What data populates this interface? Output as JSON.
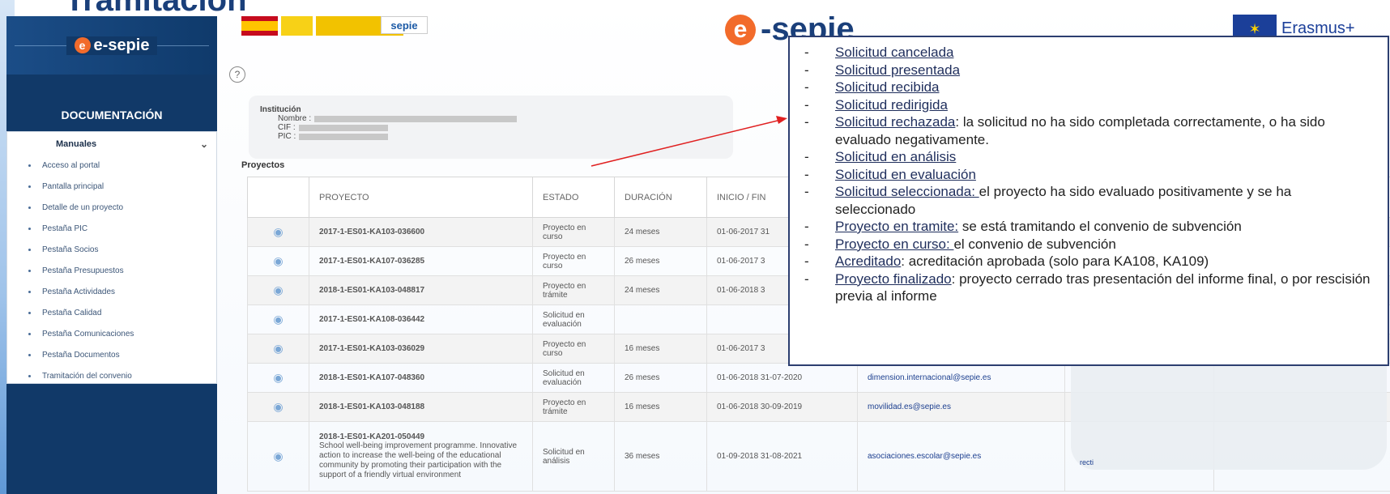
{
  "slide": {
    "title": "Tramitación"
  },
  "sidebar": {
    "logo_text": "e-sepie",
    "heading": "DOCUMENTACIÓN",
    "section": "Manuales",
    "items": [
      {
        "label": "Acceso al portal"
      },
      {
        "label": "Pantalla principal"
      },
      {
        "label": "Detalle de un proyecto"
      },
      {
        "label": "Pestaña PIC"
      },
      {
        "label": "Pestaña Socios"
      },
      {
        "label": "Pestaña Presupuestos"
      },
      {
        "label": "Pestaña Actividades"
      },
      {
        "label": "Pestaña Calidad"
      },
      {
        "label": "Pestaña Comunicaciones"
      },
      {
        "label": "Pestaña Documentos"
      },
      {
        "label": "Tramitación del convenio"
      }
    ]
  },
  "header": {
    "sepie_small": "sepie",
    "esepie_big": "-sepie",
    "erasmus": "Erasmus+"
  },
  "institution": {
    "label": "Institución",
    "nombre_label": "Nombre :",
    "cif_label": "CIF :",
    "pic_label": "PIC :"
  },
  "projects": {
    "label": "Proyectos",
    "columns": [
      "PROYECTO",
      "ESTADO",
      "DURACIÓN",
      "INICIO / FIN"
    ],
    "rows": [
      {
        "proyecto": "2017-1-ES01-KA103-036600",
        "estado": "Proyecto en curso",
        "duracion": "24 meses",
        "fechas": "01-06-2017 31",
        "email": ""
      },
      {
        "proyecto": "2017-1-ES01-KA107-036285",
        "estado": "Proyecto en curso",
        "duracion": "26 meses",
        "fechas": "01-06-2017 3",
        "email": ""
      },
      {
        "proyecto": "2018-1-ES01-KA103-048817",
        "estado": "Proyecto en trámite",
        "duracion": "24 meses",
        "fechas": "01-06-2018 3",
        "email": ""
      },
      {
        "proyecto": "2017-1-ES01-KA108-036442",
        "estado": "Solicitud en evaluación",
        "duracion": "",
        "fechas": "",
        "email": ""
      },
      {
        "proyecto": "2017-1-ES01-KA103-036029",
        "estado": "Proyecto en curso",
        "duracion": "16 meses",
        "fechas": "01-06-2017 3",
        "email": ""
      },
      {
        "proyecto": "2018-1-ES01-KA107-048360",
        "estado": "Solicitud en evaluación",
        "duracion": "26 meses",
        "fechas": "01-06-2018 31-07-2020",
        "email": "dimension.internacional@sepie.es"
      },
      {
        "proyecto": "2018-1-ES01-KA103-048188",
        "estado": "Proyecto en trámite",
        "duracion": "16 meses",
        "fechas": "01-06-2018 30-09-2019",
        "email": "movilidad.es@sepie.es"
      },
      {
        "proyecto": "2018-1-ES01-KA201-050449",
        "sub": "School well-being improvement programme. Innovative action to increase the well-being of the educational community by promoting their participation with the support of a friendly virtual environment",
        "estado": "Solicitud en análisis",
        "duracion": "36 meses",
        "fechas": "01-09-2018 31-08-2021",
        "email": "asociaciones.escolar@sepie.es"
      }
    ],
    "extra_cell": "recti"
  },
  "legend": {
    "items": [
      {
        "term": "Solicitud cancelada",
        "desc": ""
      },
      {
        "term": "Solicitud presentada",
        "desc": ""
      },
      {
        "term": "Solicitud recibida",
        "desc": ""
      },
      {
        "term": "Solicitud redirigida",
        "desc": ""
      },
      {
        "term": "Solicitud rechazada",
        "desc": ": la solicitud no ha sido completada correctamente, o ha sido evaluado negativamente."
      },
      {
        "term": "Solicitud en análisis",
        "desc": ""
      },
      {
        "term": "Solicitud en evaluación",
        "desc": ""
      },
      {
        "term": "Solicitud seleccionada: ",
        "desc": "el proyecto ha sido evaluado positivamente y se ha seleccionado"
      },
      {
        "term": "Proyecto en tramite:",
        "desc": " se está tramitando el convenio de subvención"
      },
      {
        "term": "Proyecto en curso: ",
        "desc": "el convenio de subvención"
      },
      {
        "term": "Acreditado",
        "desc": ": acreditación aprobada (solo para KA108, KA109)"
      },
      {
        "term": "Proyecto finalizado",
        "desc": ": proyecto cerrado tras presentación del informe final, o por rescisión previa al informe"
      }
    ]
  },
  "colors": {
    "sidebar": "#113968",
    "accent": "#f26b2b",
    "arrow": "#e02020",
    "legend_border": "#2c3e70"
  }
}
